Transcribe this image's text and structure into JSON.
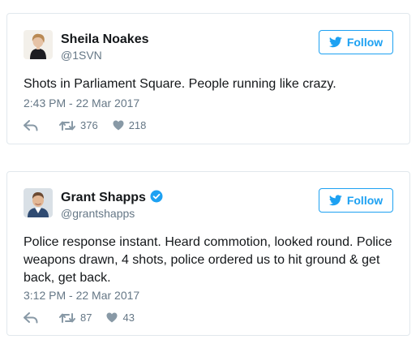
{
  "colors": {
    "accent": "#1da1f2",
    "secondary_text": "#657786",
    "border": "#e1e8ed"
  },
  "tweets": [
    {
      "author": "Sheila Noakes",
      "handle": "@1SVN",
      "verified": false,
      "follow_label": "Follow",
      "text": "Shots in Parliament Square. People running like crazy.",
      "timestamp": "2:43 PM - 22 Mar 2017",
      "retweets": "376",
      "likes": "218",
      "icons": [
        "reply-icon",
        "retweet-icon",
        "heart-icon",
        "twitter-bird-icon"
      ]
    },
    {
      "author": "Grant Shapps",
      "handle": "@grantshapps",
      "verified": true,
      "follow_label": "Follow",
      "text": "Police response instant. Heard commotion, looked round. Police weapons drawn, 4 shots, police ordered us to hit ground & get back, get back.",
      "timestamp": "3:12 PM - 22 Mar 2017",
      "retweets": "87",
      "likes": "43",
      "icons": [
        "verified-badge-icon",
        "reply-icon",
        "retweet-icon",
        "heart-icon",
        "twitter-bird-icon"
      ]
    }
  ]
}
